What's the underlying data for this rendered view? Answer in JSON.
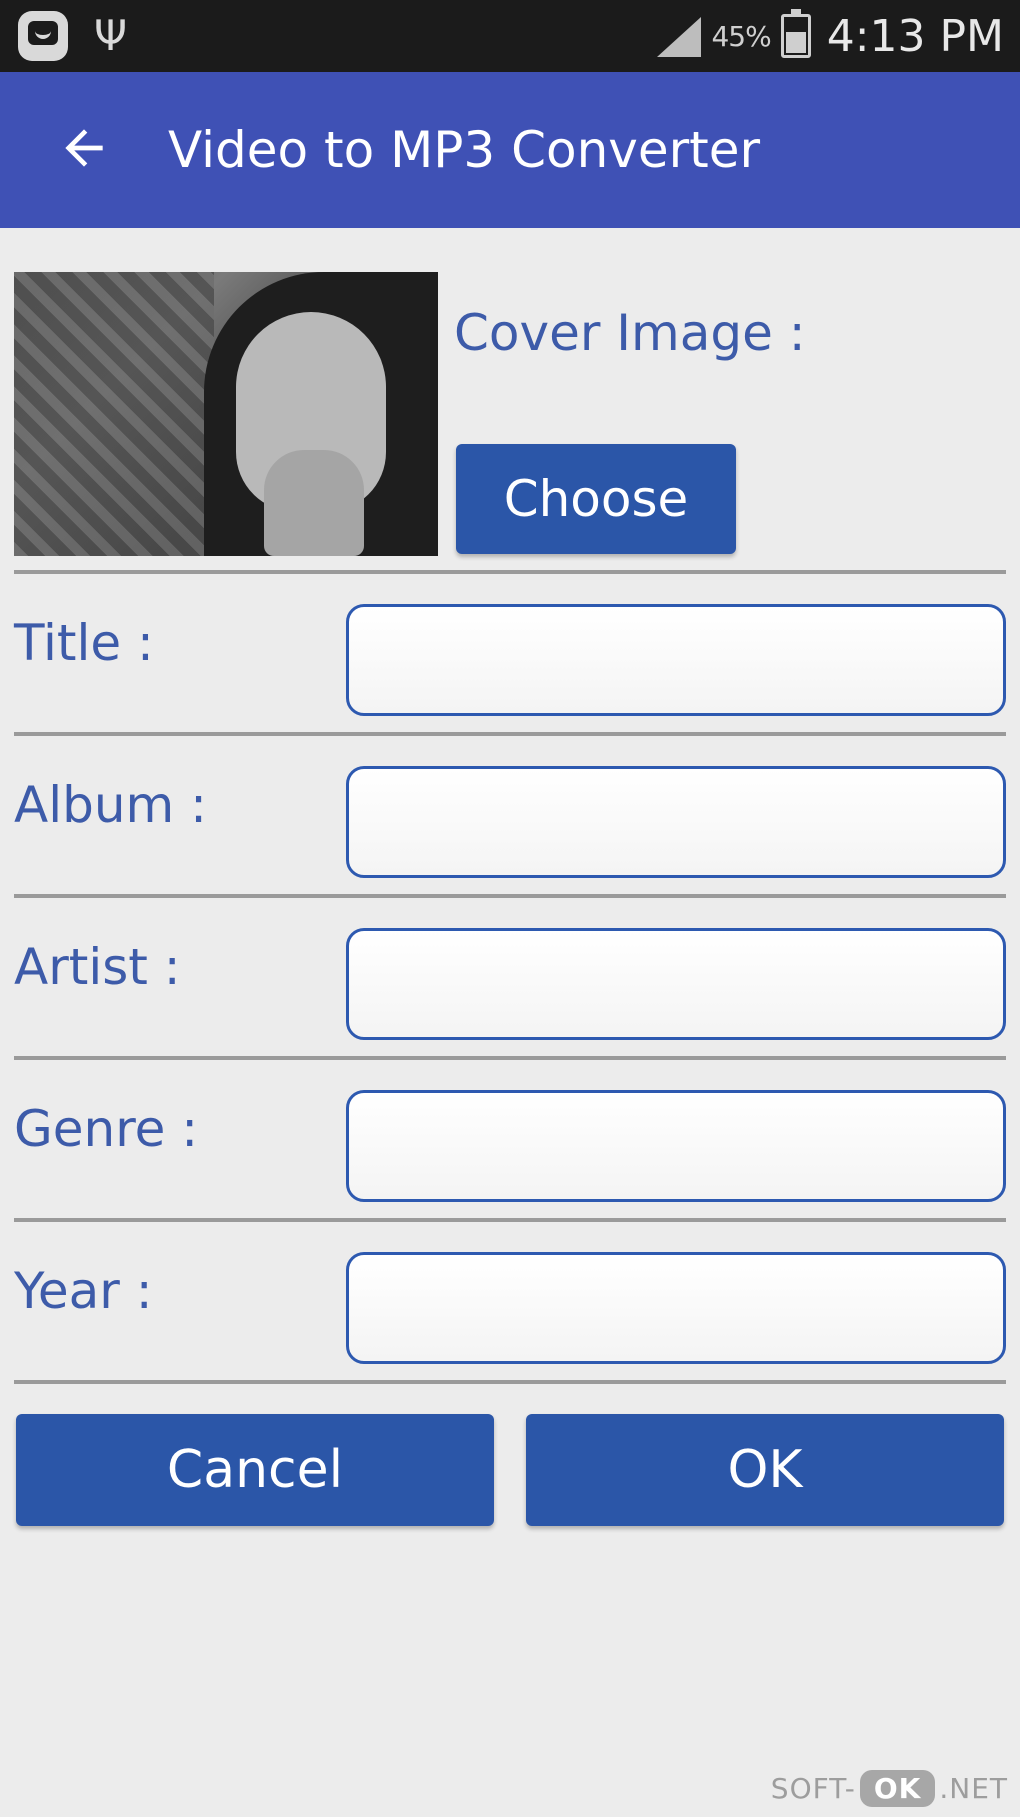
{
  "status_bar": {
    "battery_percent": "45%",
    "time": "4:13 PM",
    "icons": [
      "app-notification-icon",
      "usb-icon",
      "signal-icon",
      "battery-icon"
    ]
  },
  "app_bar": {
    "title": "Video to MP3 Converter",
    "back_icon": "arrow-back-icon",
    "background_color": "#3f51b5"
  },
  "cover": {
    "label": "Cover Image :",
    "choose_label": "Choose"
  },
  "form": {
    "fields": [
      {
        "label": "Title :",
        "value": ""
      },
      {
        "label": "Album :",
        "value": ""
      },
      {
        "label": "Artist :",
        "value": ""
      },
      {
        "label": "Genre :",
        "value": ""
      },
      {
        "label": "Year :",
        "value": ""
      }
    ]
  },
  "actions": {
    "cancel_label": "Cancel",
    "ok_label": "OK",
    "button_color": "#2b56a8"
  },
  "watermark": {
    "prefix": "SOFT-",
    "badge": "OK",
    "suffix": ".NET"
  }
}
